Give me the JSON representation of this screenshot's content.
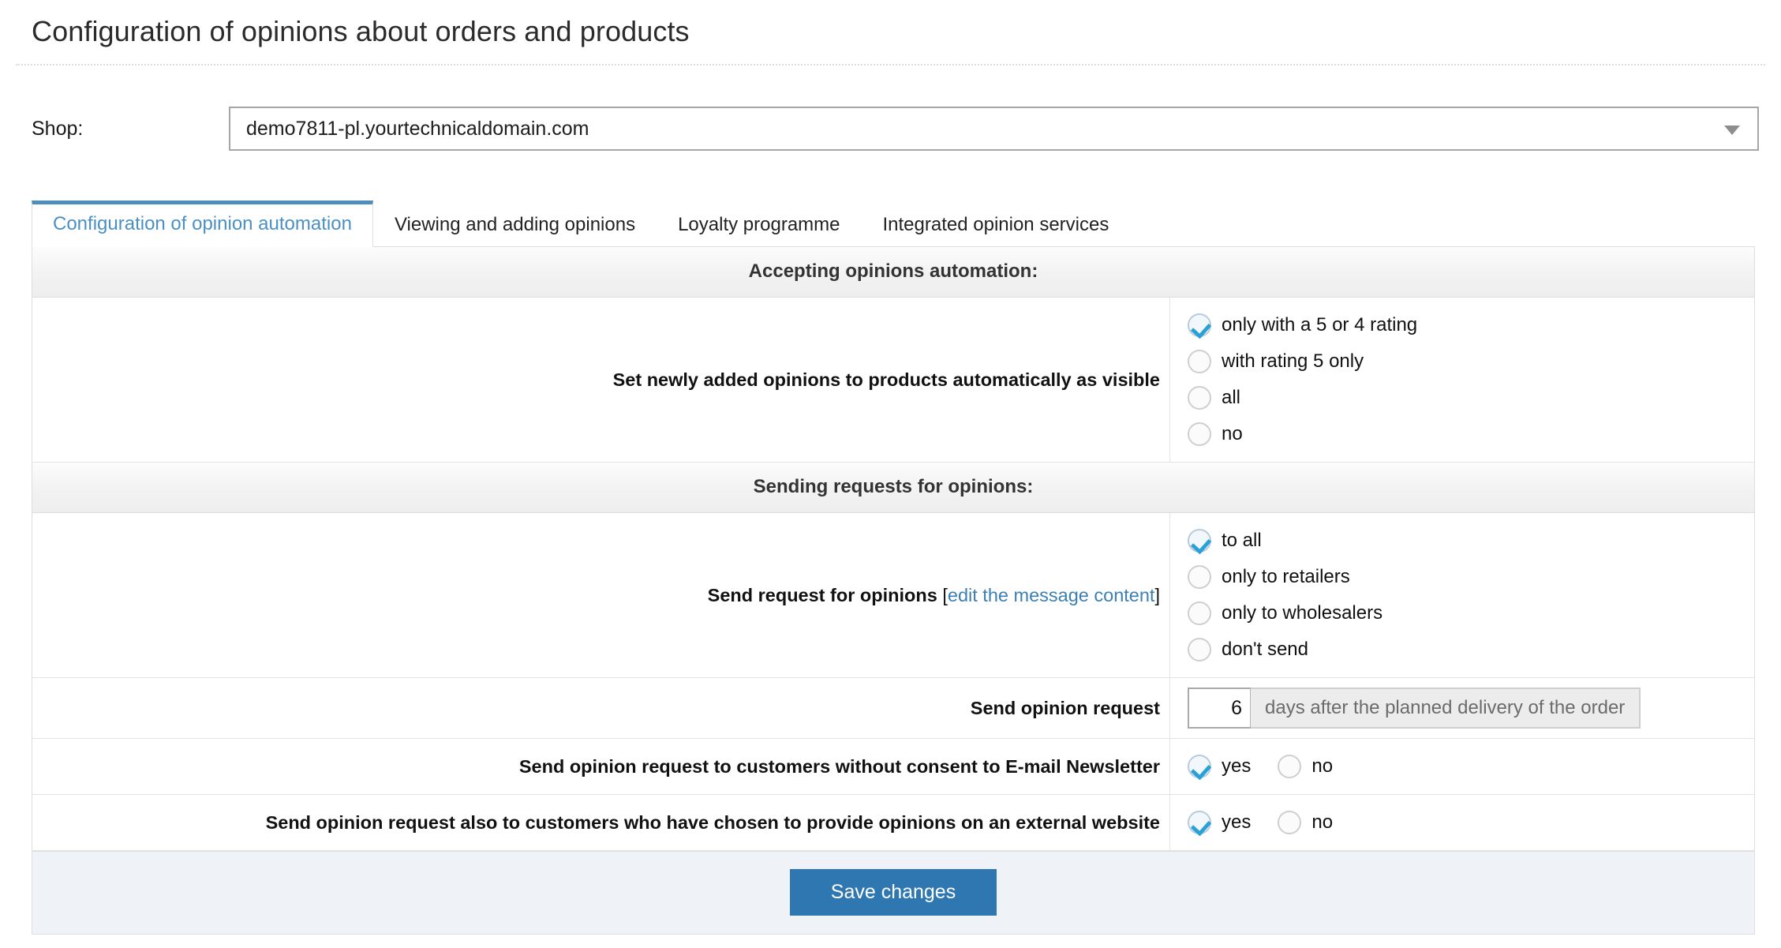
{
  "page": {
    "title": "Configuration of opinions about orders and products"
  },
  "shop": {
    "label": "Shop:",
    "value": "demo7811-pl.yourtechnicaldomain.com",
    "caret_icon": "chevron-down-icon"
  },
  "tabs": [
    {
      "label": "Configuration of opinion automation",
      "active": true
    },
    {
      "label": "Viewing and adding opinions",
      "active": false
    },
    {
      "label": "Loyalty programme",
      "active": false
    },
    {
      "label": "Integrated opinion services",
      "active": false
    }
  ],
  "sections": {
    "accepting": {
      "heading": "Accepting opinions automation:",
      "visibility_row": {
        "label": "Set newly added opinions to products automatically as visible",
        "options": [
          {
            "label": "only with a 5 or 4 rating",
            "checked": true
          },
          {
            "label": "with rating 5 only",
            "checked": false
          },
          {
            "label": "all",
            "checked": false
          },
          {
            "label": "no",
            "checked": false
          }
        ]
      }
    },
    "sending": {
      "heading": "Sending requests for opinions:",
      "request_row": {
        "label": "Send request for opinions",
        "link": "edit the message content",
        "bracket_open": "[",
        "bracket_close": "]",
        "options": [
          {
            "label": "to all",
            "checked": true
          },
          {
            "label": "only to retailers",
            "checked": false
          },
          {
            "label": "only to wholesalers",
            "checked": false
          },
          {
            "label": "don't send",
            "checked": false
          }
        ]
      },
      "delay_row": {
        "label": "Send opinion request",
        "value": "6",
        "placeholder": "6",
        "addon": "days after the planned delivery of the order"
      },
      "newsletter_row": {
        "label": "Send opinion request to customers without consent to E-mail Newsletter",
        "options": [
          {
            "label": "yes",
            "checked": true
          },
          {
            "label": "no",
            "checked": false
          }
        ]
      },
      "external_row": {
        "label": "Send opinion request also to customers who have chosen to provide opinions on an external website",
        "options": [
          {
            "label": "yes",
            "checked": true
          },
          {
            "label": "no",
            "checked": false
          }
        ]
      }
    }
  },
  "footer": {
    "save_label": "Save changes"
  },
  "colors": {
    "accent": "#2f77b0",
    "tab_active": "#4a90c4",
    "link": "#3c7fb1",
    "check": "#29a0d8",
    "footer_bg": "#eff2f7"
  }
}
